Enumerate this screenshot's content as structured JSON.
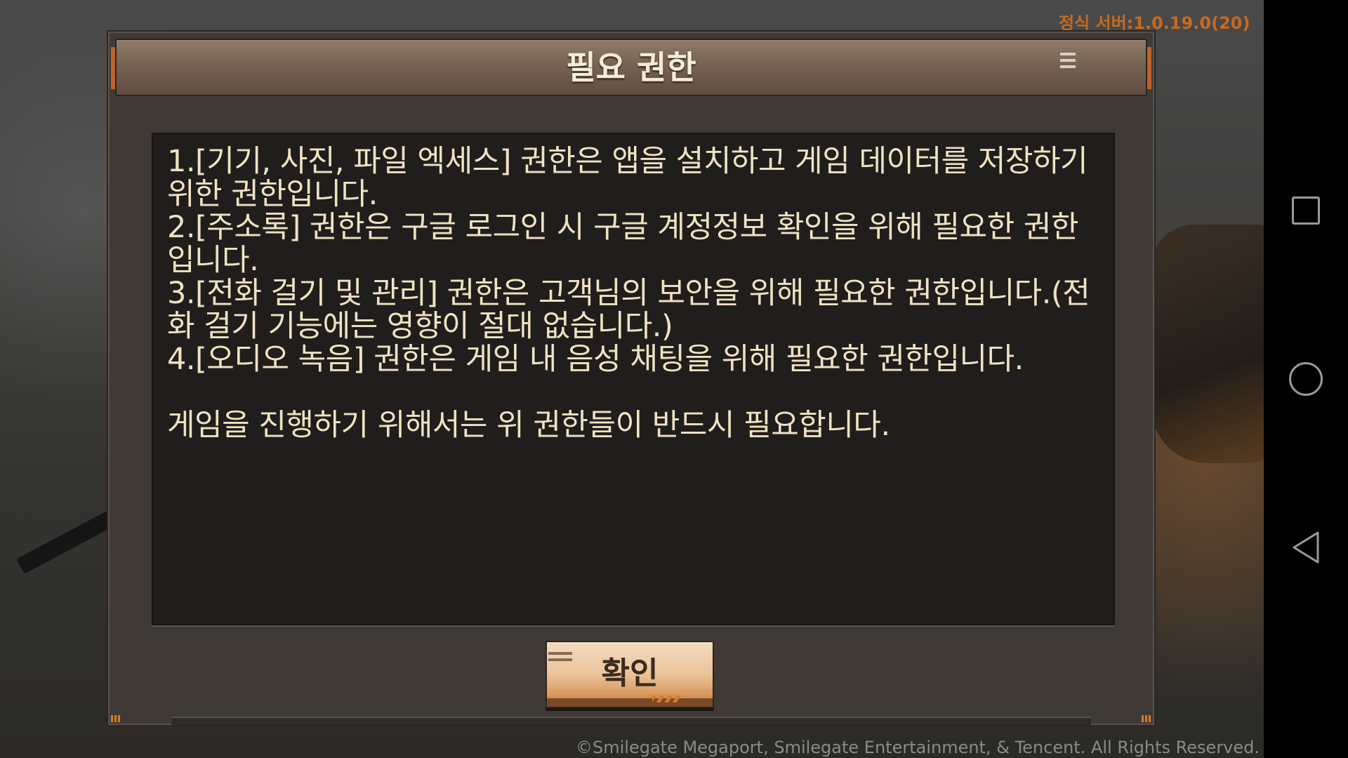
{
  "status": {
    "server_version": "정식 서버:1.0.19.0(20)",
    "copyright": "©Smilegate Megaport, Smilegate Entertainment, & Tencent. All Rights Reserved."
  },
  "dialog": {
    "title": "필요 권한",
    "menu_icon": "menu-icon",
    "body": "1.[기기, 사진, 파일 엑세스] 권한은 앱을 설치하고 게임 데이터를 저장하기 위한 권한입니다.\n2.[주소록] 권한은 구글 로그인 시 구글 계정정보 확인을 위해 필요한 권한입니다.\n3.[전화 걸기 및 관리] 권한은 고객님의 보안을 위해 필요한 권한입니다.(전화 걸기 기능에는 영향이 절대 없습니다.)\n4.[오디오 녹음] 권한은 게임 내 음성 채팅을 위해 필요한 권한입니다.\n\n게임을 진행하기 위해서는 위 권한들이 반드시 필요합니다.",
    "confirm_label": "확인"
  },
  "navigation_bar": {
    "buttons": [
      "recent-apps-icon",
      "home-icon",
      "back-icon"
    ]
  },
  "colors": {
    "accent_orange": "#c86a1e",
    "text_cream": "#efe2c2",
    "panel_dark": "#201e1c"
  }
}
